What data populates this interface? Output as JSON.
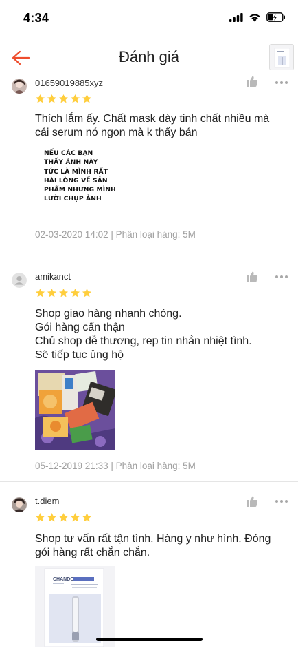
{
  "status_bar": {
    "time": "4:34"
  },
  "header": {
    "title": "Đánh giá"
  },
  "reviews": [
    {
      "username": "01659019885xyz",
      "rating": 5,
      "text_lines": [
        "Thích lắm ấy. Chất mask dày tinh chất nhiều mà",
        "cái serum nó ngon mà k thấy bán"
      ],
      "image_text": [
        "NẾU CÁC BẠN",
        "THẤY ẢNH NÀY",
        "TỨC LÀ MÌNH RẤT",
        "HÀI LÒNG VỀ SẢN",
        "PHẨM NHƯNG MÌNH",
        "LƯỜI CHỤP ẢNH"
      ],
      "meta": "02-03-2020 14:02 | Phân loại hàng: 5M"
    },
    {
      "username": "amikanct",
      "rating": 5,
      "text_lines": [
        "Shop giao hàng nhanh chóng.",
        "Gói hàng cẩn thận",
        "Chủ shop dễ thương, rep tin nhắn nhiệt tình.",
        "Sẽ tiếp tục ủng hộ"
      ],
      "meta": "05-12-2019 21:33 | Phân loại hàng: 5M"
    },
    {
      "username": "t.diem",
      "rating": 5,
      "text_lines": [
        "Shop tư vấn rất tận tình. Hàng y như hình. Đóng",
        "gói hàng rất chắn chắn."
      ],
      "photo_brand": "CHANDO"
    }
  ],
  "colors": {
    "accent": "#ee4d2d",
    "star": "#ffce3d",
    "muted": "#a0a0a0"
  }
}
